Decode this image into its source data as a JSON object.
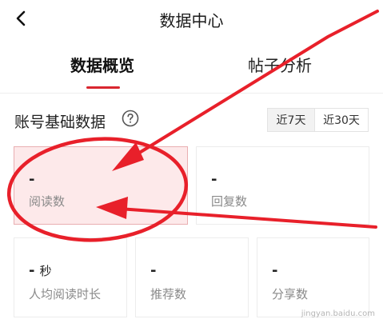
{
  "header": {
    "title": "数据中心",
    "back_icon": "chevron-left-icon"
  },
  "tabs": [
    {
      "label": "数据概览",
      "active": true
    },
    {
      "label": "帖子分析",
      "active": false
    }
  ],
  "section": {
    "title": "账号基础数据",
    "help_icon": "question-circle-icon",
    "ranges": [
      {
        "label": "近7天",
        "selected": true
      },
      {
        "label": "近30天",
        "selected": false
      }
    ]
  },
  "metrics": [
    {
      "value": "-",
      "unit": "",
      "label": "阅读数",
      "selected": true
    },
    {
      "value": "-",
      "unit": "",
      "label": "回复数",
      "selected": false
    },
    {
      "value": "-",
      "unit": "秒",
      "label": "人均阅读时长",
      "selected": false
    },
    {
      "value": "-",
      "unit": "",
      "label": "推荐数",
      "selected": false
    },
    {
      "value": "-",
      "unit": "",
      "label": "分享数",
      "selected": false
    }
  ],
  "colors": {
    "accent": "#d9262f",
    "annotation": "#e8202a",
    "selected_card_bg": "#fde9ea"
  },
  "watermark": "jingyan.baidu.com"
}
